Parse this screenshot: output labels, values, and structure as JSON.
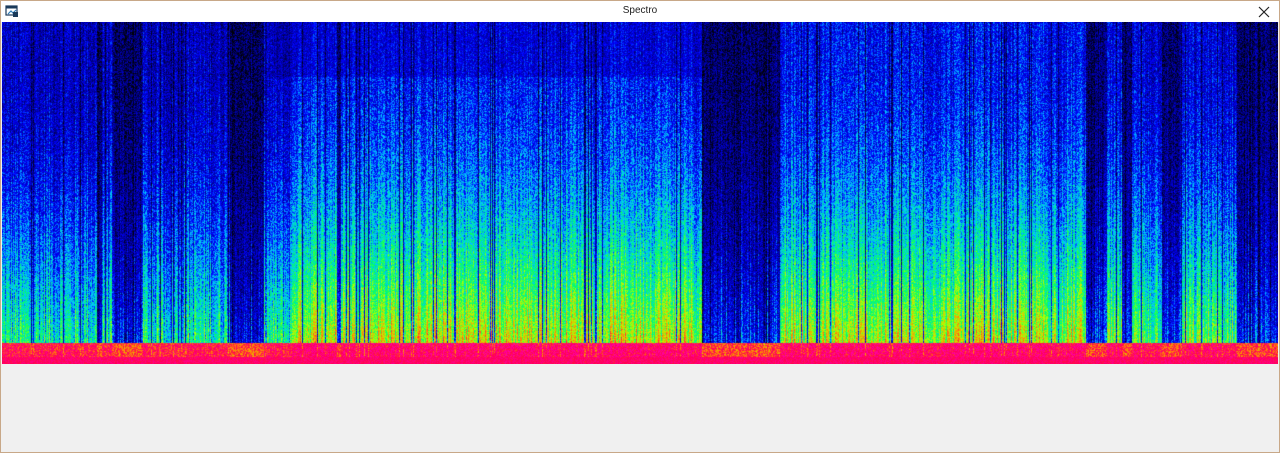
{
  "window": {
    "title": "Spectro",
    "icons": {
      "app": "app-window-icon",
      "close": "close-icon"
    }
  },
  "spectrogram": {
    "palette": [
      "#000000",
      "#00008b",
      "#0000ff",
      "#00c8ff",
      "#00ff64",
      "#b4ff00",
      "#ff8c00",
      "#ff0050",
      "#ff00a0"
    ],
    "background_color": "#000000",
    "client_background": "#f0f0f0"
  }
}
